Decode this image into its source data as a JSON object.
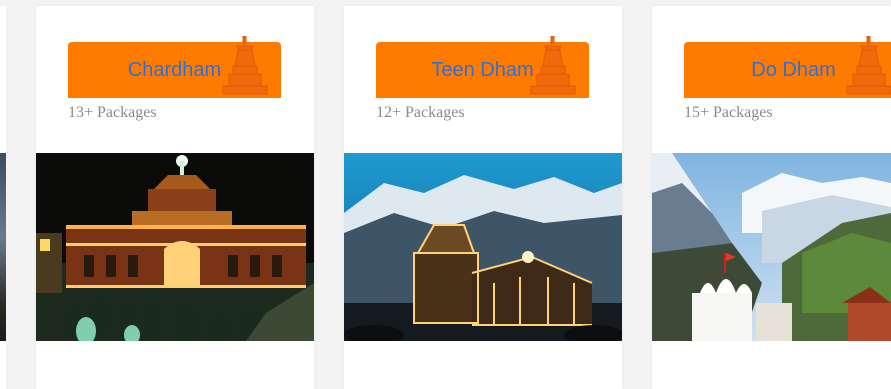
{
  "cards": [
    {
      "title": "Chardham",
      "packages": "13+ Packages",
      "photo": "badrinath-temple-night"
    },
    {
      "title": "Teen Dham",
      "packages": "12+ Packages",
      "photo": "kedarnath-temple-night"
    },
    {
      "title": "Do Dham",
      "packages": "15+ Packages",
      "photo": "gangotri-temple-mountains"
    }
  ],
  "colors": {
    "accent": "#ff7b00",
    "title_text": "#2e6fd6",
    "muted": "#8a8a8a"
  },
  "icons": {
    "title_decoration": "temple-icon"
  }
}
